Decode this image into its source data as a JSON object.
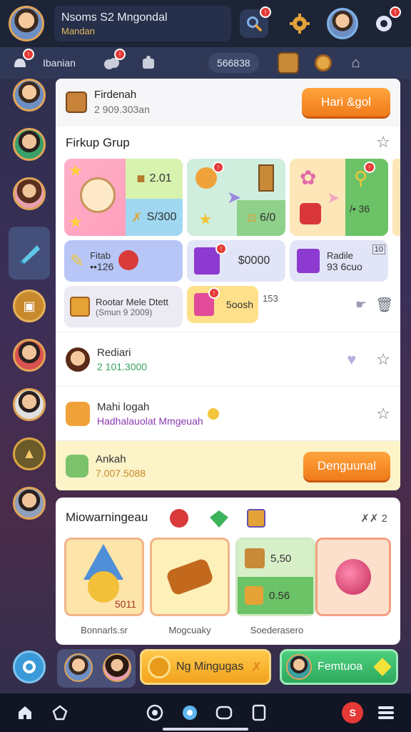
{
  "header": {
    "title": "Nsoms S2 Mngondal",
    "subtitle": "Mandan",
    "search_icon": "search-icon",
    "gear_icon": "gear-icon",
    "chat_icon": "chat-icon"
  },
  "subbar": {
    "tab_label": "Ibanian",
    "counter": "566838"
  },
  "panel": {
    "top_row": {
      "title": "Firdenah",
      "value": "2 909.303an",
      "button": "Hari &gol"
    },
    "group": {
      "title": "Firkup Grup",
      "tile1_value": "2.01",
      "tile2_value": "S/300",
      "tile3_value": "6/0",
      "tile4_value": "/• 36",
      "row2_tile1_label": "Fitab",
      "row2_tile1_value": "••126",
      "row2_tile2_value": "$0000",
      "row2_tile3_label": "Radile",
      "row2_tile3_value": "93 6cuo",
      "row2_tile3_badge": "10",
      "row3_tile1_title": "Rootar Mele Dtett",
      "row3_tile1_sub": "(Smun 9 2009)",
      "row3_tile2_value": "5oosh",
      "row3_count": "153"
    },
    "rows": [
      {
        "title": "Rediari",
        "value": "2 101.3000"
      },
      {
        "title": "Mahi logah",
        "value": "Hadhalauolat Mmgeuah"
      }
    ],
    "bottom_row": {
      "title": "Ankah",
      "value": "7.007.5088",
      "button": "Denguunal"
    }
  },
  "rewards": {
    "title": "Miowarningeau",
    "counter": "2",
    "card3_value_top": "5,50",
    "card3_value_bottom": "0.56",
    "card1_value": "5011",
    "labels": [
      "Bonnarls.sr",
      "Mogcuaky",
      "Soederasero"
    ]
  },
  "actionbar": {
    "button1": "Ng Mingugas",
    "button2": "Femtuoa"
  },
  "colors": {
    "accent_orange": "#f07a1a",
    "badge_red": "#e53935",
    "green_button": "#3bb56a",
    "bar_dark": "#1d2436"
  }
}
